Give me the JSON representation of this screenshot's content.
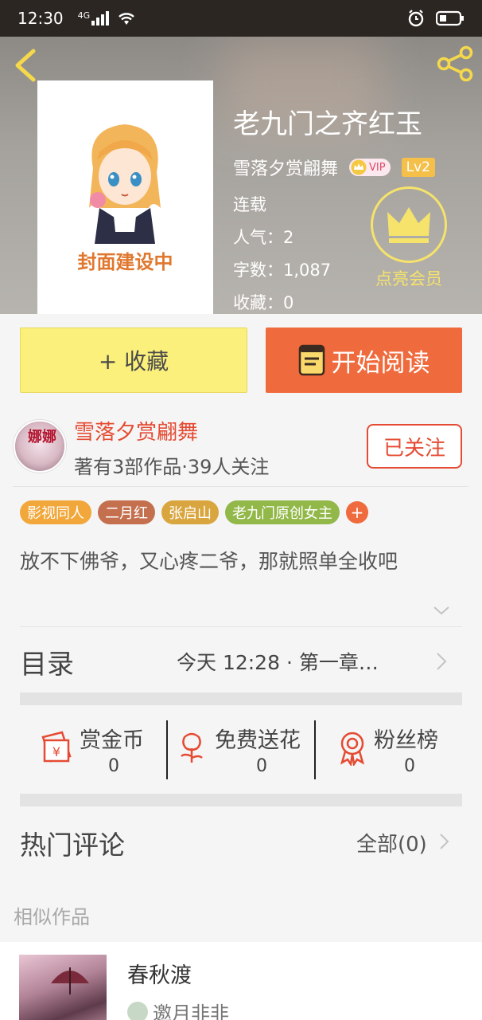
{
  "status_bar": {
    "time": "12:30",
    "network": "4G"
  },
  "book": {
    "title": "老九门之齐红玉",
    "cover_caption": "封面建设中",
    "author": "雪落夕赏翩舞",
    "vip_badge": "VIP",
    "level_badge": "Lv2",
    "status": "连载",
    "popularity": "人气：2",
    "word_count": "字数：1,087",
    "favorites": "收藏：0",
    "member_label": "点亮会员"
  },
  "actions": {
    "favorite_label": "+ 收藏",
    "read_label": "开始阅读"
  },
  "author_info": {
    "avatar_text": "娜娜",
    "name": "雪落夕赏翩舞",
    "stats": "著有3部作品·39人关注",
    "follow_label": "已关注"
  },
  "tags": [
    {
      "label": "影视同人",
      "color": "#f2a73a"
    },
    {
      "label": "二月红",
      "color": "#c4704f"
    },
    {
      "label": "张启山",
      "color": "#d9a53e"
    },
    {
      "label": "老九门原创女主",
      "color": "#93b84a"
    }
  ],
  "tag_more": "+",
  "summary": "放不下佛爷，又心疼二爷，那就照单全收吧",
  "directory": {
    "label": "目录",
    "latest": "今天 12:28 · 第一章…"
  },
  "support": [
    {
      "label": "赏金币",
      "count": "0",
      "icon": "red-envelope-icon"
    },
    {
      "label": "免费送花",
      "count": "0",
      "icon": "flower-icon"
    },
    {
      "label": "粉丝榜",
      "count": "0",
      "icon": "medal-icon"
    }
  ],
  "comments": {
    "title": "热门评论",
    "all_label": "全部(0)"
  },
  "similar": {
    "label": "相似作品",
    "items": [
      {
        "title": "春秋渡",
        "author": "邀月非非"
      }
    ]
  },
  "colors": {
    "accent": "#ef6a3c",
    "favorite_bg": "#fbf07c",
    "author": "#e54b33",
    "member": "#f5e36b"
  }
}
